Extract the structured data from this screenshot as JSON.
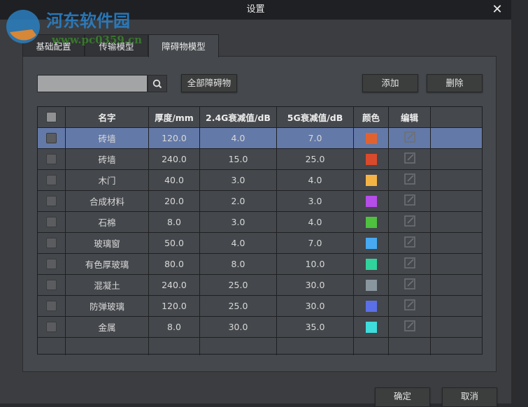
{
  "title": "设置",
  "watermark": {
    "name": "河东软件园",
    "url": "www.pc0359.cn"
  },
  "tabs": [
    "基础配置",
    "传输模型",
    "障碍物模型"
  ],
  "search": {
    "value": "",
    "placeholder": ""
  },
  "buttons": {
    "all": "全部障碍物",
    "add": "添加",
    "delete": "删除",
    "ok": "确定",
    "cancel": "取消"
  },
  "columns": [
    "名字",
    "厚度/mm",
    "2.4G衰减值/dB",
    "5G衰减值/dB",
    "颜色",
    "编辑"
  ],
  "rows": [
    {
      "name": "砖墙",
      "thickness": "120.0",
      "g24": "4.0",
      "g5": "7.0",
      "color": "#e2622f",
      "selected": true
    },
    {
      "name": "砖墙",
      "thickness": "240.0",
      "g24": "15.0",
      "g5": "25.0",
      "color": "#d84a2b"
    },
    {
      "name": "木门",
      "thickness": "40.0",
      "g24": "3.0",
      "g5": "4.0",
      "color": "#f4b445"
    },
    {
      "name": "合成材料",
      "thickness": "20.0",
      "g24": "2.0",
      "g5": "3.0",
      "color": "#b54de8"
    },
    {
      "name": "石棉",
      "thickness": "8.0",
      "g24": "3.0",
      "g5": "4.0",
      "color": "#4ec13f"
    },
    {
      "name": "玻璃窗",
      "thickness": "50.0",
      "g24": "4.0",
      "g5": "7.0",
      "color": "#47a9f2"
    },
    {
      "name": "有色厚玻璃",
      "thickness": "80.0",
      "g24": "8.0",
      "g5": "10.0",
      "color": "#2fd39b"
    },
    {
      "name": "混凝土",
      "thickness": "240.0",
      "g24": "25.0",
      "g5": "30.0",
      "color": "#8a969e"
    },
    {
      "name": "防弹玻璃",
      "thickness": "120.0",
      "g24": "25.0",
      "g5": "30.0",
      "color": "#5b6fe8"
    },
    {
      "name": "金属",
      "thickness": "8.0",
      "g24": "30.0",
      "g5": "35.0",
      "color": "#3fdcdc"
    }
  ]
}
